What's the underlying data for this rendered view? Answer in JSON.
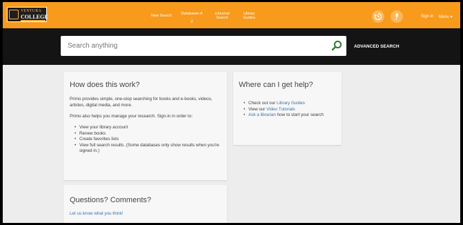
{
  "logo": {
    "line1": "VENTURA",
    "line2": "COLLEGE"
  },
  "nav": {
    "new_search": "New Search",
    "databases_line1": "Databases A -",
    "databases_line2": "Z",
    "journal_line1": "eJournal",
    "journal_line2": "Search",
    "guides_line1": "Library",
    "guides_line2": "Guides"
  },
  "header": {
    "icons": [
      "history-icon",
      "pin-icon"
    ],
    "sign_in": "Sign in",
    "menu": "Menu ▾"
  },
  "search": {
    "placeholder": "Search anything",
    "advanced": "ADVANCED SEARCH"
  },
  "how_card": {
    "title": "How does this work?",
    "intro": "Primo provides simple, one-stop searching for books and e-books, videos, articles, digital media, and more.",
    "intro2": "Primo also helps you manage your research. Sign-in in order to:",
    "items": [
      "View your library account",
      "Renew books",
      "Create favorites lists",
      "View full search results. (Some databases only show results when you're signed in.)"
    ]
  },
  "help_card": {
    "title": "Where can I get help?",
    "item1_pre": "Check out our ",
    "item1_link": "Library Guides",
    "item2_pre": "View our ",
    "item2_link": "Video Tutorials",
    "item3_link": "Ask a librarian",
    "item3_post": " how to start your search"
  },
  "questions_card": {
    "title": "Questions? Comments?",
    "link": "Let us know what you think!"
  },
  "colors": {
    "header_orange": "#f89a1c",
    "search_band": "#141414",
    "search_green": "#2e7d32",
    "link_blue": "#3a6fa8",
    "page_bg": "#ededed"
  }
}
